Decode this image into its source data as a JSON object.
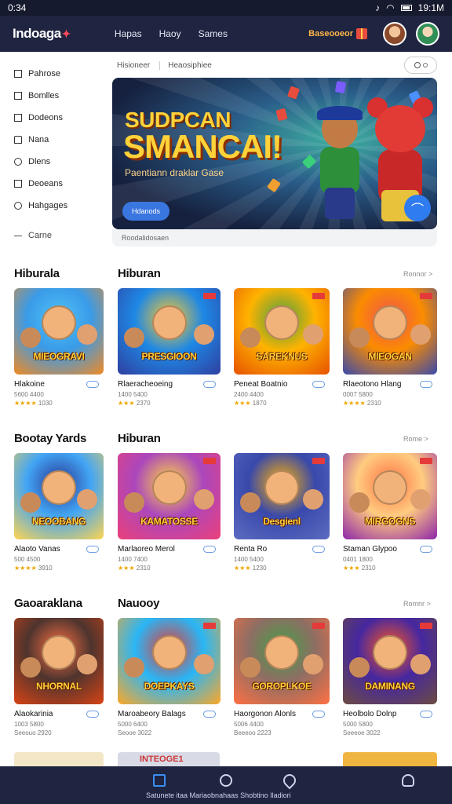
{
  "status": {
    "time": "0:34",
    "clock_right": "19:1M",
    "icons": [
      "tiktok-icon",
      "wifi-icon",
      "battery-icon"
    ]
  },
  "header": {
    "logo": "Indoaga",
    "nav": [
      "Hapas",
      "Haoy",
      "Sames"
    ],
    "points_label": "Baseooeor"
  },
  "sidebar": {
    "items": [
      {
        "label": "Pahrose",
        "icon": "square-icon"
      },
      {
        "label": "Bomlles",
        "icon": "square-icon"
      },
      {
        "label": "Dodeons",
        "icon": "checkbox-icon"
      },
      {
        "label": "Nana",
        "icon": "house-icon"
      },
      {
        "label": "Dlens",
        "icon": "chat-icon"
      },
      {
        "label": "Deoeans",
        "icon": "square-icon"
      },
      {
        "label": "Hahgages",
        "icon": "chat-icon"
      }
    ],
    "extra": "Carne"
  },
  "search": {
    "crumb1": "Hisioneer",
    "crumb2": "Heaosiphiee"
  },
  "hero": {
    "title_line1": "SUDPCAN",
    "title_line2": "SMANCAI!",
    "subtitle": "Paentiann draklar Gase",
    "button": "Hdanods",
    "caption": "Roodalidosaen"
  },
  "sections": [
    {
      "left_title": "Hiburala",
      "right_title": "Hiburan",
      "more": "Ronnor >",
      "cards": [
        {
          "art_title": "MIEOGRAVI",
          "title": "Hlakoine",
          "sub": "5600 4400",
          "rating": "★★★★",
          "count": "1030"
        },
        {
          "art_title": "PRESGIOON",
          "title": "Rlaeracheoeing",
          "sub": "1400 5400",
          "rating": "★★★",
          "count": "2370"
        },
        {
          "art_title": "SAREKNUS",
          "title": "Peneat Boatnio",
          "sub": "2400 4400",
          "rating": "★★★",
          "count": "1870"
        },
        {
          "art_title": "MIEOGAN",
          "title": "Rlaeotono Hlang",
          "sub": "0007 5800",
          "rating": "★★★★",
          "count": "2310"
        }
      ]
    },
    {
      "left_title": "Bootay Yards",
      "right_title": "Hiburan",
      "more": "Rome >",
      "cards": [
        {
          "art_title": "NEOOBANG",
          "title": "Alaoto Vanas",
          "sub": "500 4500",
          "rating": "★★★★",
          "count": "3910"
        },
        {
          "art_title": "KAMATOSSE",
          "title": "Marlaoreo Merol",
          "sub": "1400 7400",
          "rating": "★★★",
          "count": "2310"
        },
        {
          "art_title": "Desgienl",
          "title": "Renta Ro",
          "sub": "1400 5400",
          "rating": "★★★",
          "count": "1230"
        },
        {
          "art_title": "MIRGOGNS",
          "title": "Staman Glypoo",
          "sub": "0401 1800",
          "rating": "★★★",
          "count": "2310"
        }
      ]
    },
    {
      "left_title": "Gaoaraklana",
      "right_title": "Nauooy",
      "more": "Romnr >",
      "cards": [
        {
          "art_title": "NHORNAL",
          "title": "Alaokarinia",
          "sub": "1003 5800",
          "count": "Seeouo 2920"
        },
        {
          "art_title": "DOEPKAYS",
          "title": "Maroabeory Balags",
          "sub": "5000 6400",
          "count": "Seooe 3022"
        },
        {
          "art_title": "GOROPLKOE",
          "title": "Haorgonon Alonls",
          "sub": "5006 4400",
          "count": "Beeeoo 2223"
        },
        {
          "art_title": "DAMINANG",
          "title": "Heolbolo Dolnp",
          "sub": "5000 5800",
          "count": "Seeeoe 3022"
        }
      ]
    }
  ],
  "bottom_nav": {
    "label": "Satunete itaa Mariaobnahaas Shobtino  Iladiori",
    "items": [
      "home-icon",
      "search-icon",
      "profile-pin-icon",
      "user-icon"
    ]
  },
  "peek_label": "INTEOGE1"
}
